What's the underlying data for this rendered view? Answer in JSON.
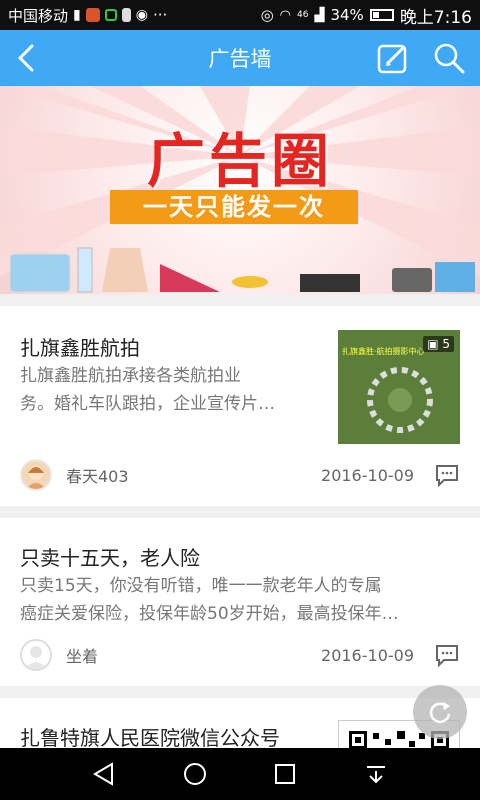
{
  "status": {
    "carrier": "中国移动",
    "signal_text": "46",
    "battery": "34%",
    "time": "晚上7:16",
    "more": "···"
  },
  "header": {
    "title": "广告墙"
  },
  "banner": {
    "title": "广告圈",
    "subtitle": "一天只能发一次"
  },
  "posts": [
    {
      "title": "扎旗鑫胜航拍",
      "desc_line1": "扎旗鑫胜航拍承接各类航拍业",
      "desc_line2": "务。婚礼车队跟拍，企业宣传片…",
      "author": "春天403",
      "date": "2016-10-09",
      "image_count": "5",
      "thumb_caption": "扎旗鑫胜·航拍摄影中心"
    },
    {
      "title": "只卖十五天，老人险",
      "desc_line1": "只卖15天，你没有听错，唯一一款老年人的专属",
      "desc_line2": "癌症关爱保险，投保年龄50岁开始，最高投保年…",
      "author": "坐着",
      "date": "2016-10-09"
    },
    {
      "title": "扎鲁特旗人民医院微信公众号"
    }
  ]
}
